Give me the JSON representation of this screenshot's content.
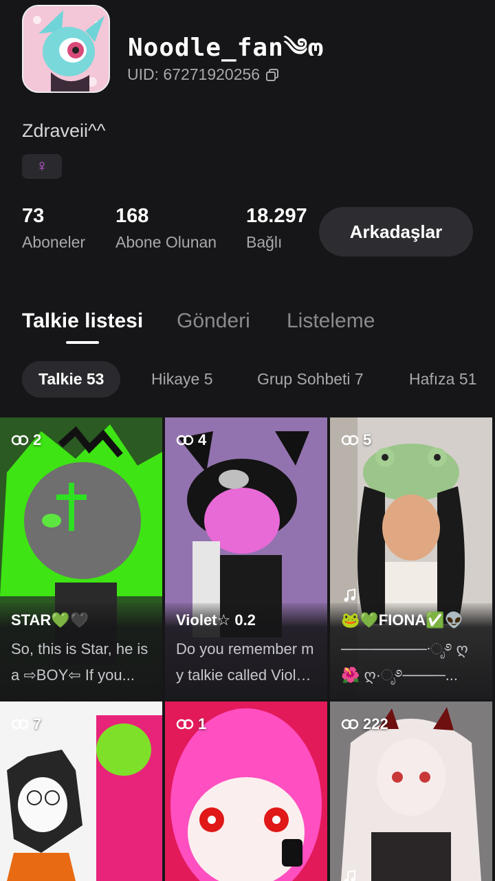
{
  "profile": {
    "username": "Noodle_fan༄ო",
    "uid_label": "UID: 67271920256",
    "bio": "Zdraveii^^",
    "gender_symbol": "♀"
  },
  "stats": [
    {
      "value": "73",
      "label": "Aboneler"
    },
    {
      "value": "168",
      "label": "Abone Olunan"
    },
    {
      "value": "18.297",
      "label": "Bağlı"
    }
  ],
  "friends_button": "Arkadaşlar",
  "tabs": [
    {
      "label": "Talkie listesi"
    },
    {
      "label": "Gönderi"
    },
    {
      "label": "Listeleme"
    }
  ],
  "chips": [
    {
      "label": "Talkie 53"
    },
    {
      "label": "Hikaye 5"
    },
    {
      "label": "Grup Sohbeti 7"
    },
    {
      "label": "Hafıza 51"
    }
  ],
  "cards": [
    {
      "count": "2",
      "title": "STAR💚🖤",
      "desc": "So, this is Star, he is a ⇨BOY⇦ If you...",
      "has_music": false
    },
    {
      "count": "4",
      "title": "Violet☆ 0.2",
      "desc": "Do you remember my talkie called Violet...",
      "has_music": false
    },
    {
      "count": "5",
      "title": "🐸💚FIONA✅👽",
      "desc": "────────·ೃ࿔ ღ 🌺 ღ·ೃ࿔────...",
      "has_music": true
    },
    {
      "count": "7",
      "title": "",
      "desc": "",
      "has_music": false
    },
    {
      "count": "1",
      "title": "",
      "desc": "",
      "has_music": false
    },
    {
      "count": "222",
      "title": "",
      "desc": "",
      "has_music": true
    }
  ],
  "colors": {
    "background": "#161618",
    "accent_gender": "#d65cf0",
    "button_bg": "#2d2d31"
  }
}
